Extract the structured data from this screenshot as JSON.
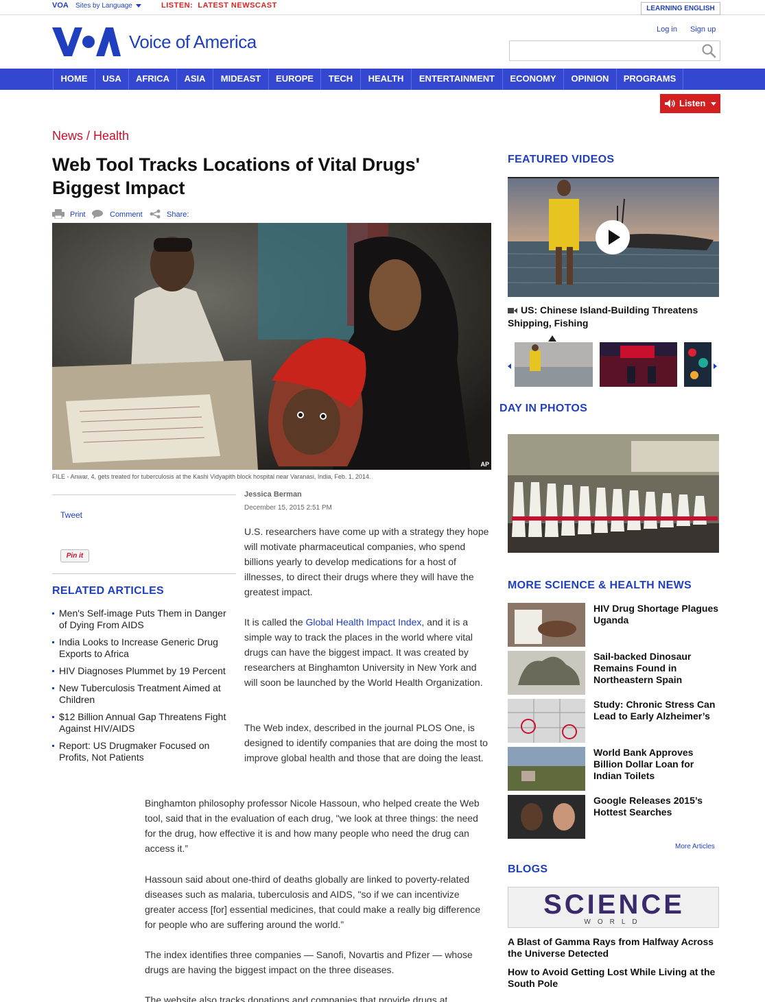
{
  "topbar": {
    "brand": "VOA",
    "sites_by_language": "Sites by Language",
    "listen_label": "LISTEN:",
    "latest_newscast": "LATEST NEWSCAST",
    "learning_english": "LEARNING ENGLISH"
  },
  "header": {
    "logo_text": "Voice of America",
    "login": "Log in",
    "signup": "Sign up",
    "search_placeholder": ""
  },
  "nav": {
    "items": [
      "HOME",
      "USA",
      "AFRICA",
      "ASIA",
      "MIDEAST",
      "EUROPE",
      "TECH",
      "HEALTH",
      "ENTERTAINMENT",
      "ECONOMY",
      "OPINION",
      "PROGRAMS"
    ]
  },
  "listen_button": "Listen",
  "article": {
    "breadcrumb": "News / Health",
    "headline": "Web Tool Tracks Locations of Vital Drugs' Biggest Impact",
    "actions": {
      "print": "Print",
      "comment": "Comment",
      "share": "Share:"
    },
    "photo_credit": "AP",
    "caption": "FILE - Anwar, 4, gets treated for tuberculosis at the Kashi Vidyapith block hospital near Varanasi, India, Feb. 1, 2014.",
    "author": "Jessica Berman",
    "date": "December 15, 2015 2:51 PM",
    "social": {
      "tweet": "Tweet",
      "pinit": "Pin it"
    },
    "paragraphs": {
      "p1": "U.S. researchers have come up with a strategy they hope will motivate pharmaceutical companies, who spend billions yearly to develop medications for a host of illnesses, to direct their drugs where they will have the greatest impact.",
      "p2_pre": "It is called the ",
      "p2_link": "Global Health Impact Index",
      "p2_post": ", and it is a simple way to track the places in the world where vital drugs can have the biggest impact. It was created by researchers at Binghamton University in New York and will soon be launched by the World Health Organization.",
      "p3": "The Web index, described in the journal PLOS One, is designed to identify companies that are doing the most to improve global health and those that are doing the least.",
      "p4": "Binghamton philosophy professor Nicole Hassoun, who helped create the Web tool, said that in the evaluation of each drug, \"we look at three things: the need for the drug, how effective it is and how many people who need the drug can access it.”",
      "p5": "Hassoun said about one-third of deaths globally are linked to poverty-related diseases such as malaria, tuberculosis and AIDS, \"so if we can incentivize greater access [for] essential medicines, that could make a really big difference for people who are suffering around the world.”",
      "p6": "The index identifies three companies — Sanofi, Novartis and Pfizer — whose drugs are having the biggest impact on the three diseases.",
      "p7": "The website also tracks donations and companies that provide drugs at"
    }
  },
  "related": {
    "title": "RELATED ARTICLES",
    "items": [
      "Men's Self-image Puts Them in Danger of Dying From AIDS",
      "India Looks to Increase Generic Drug Exports to Africa",
      "HIV Diagnoses Plummet by 19 Percent",
      "New Tuberculosis Treatment Aimed at Children",
      "$12 Billion Annual Gap Threatens Fight Against HIV/AIDS",
      "Report: US Drugmaker Focused on Profits, Not Patients"
    ]
  },
  "sidebar": {
    "featured_videos": {
      "title": "FEATURED VIDEOS",
      "video_title": "US: Chinese Island-Building Threatens Shipping, Fishing"
    },
    "day_in_photos": {
      "title": "DAY IN PHOTOS"
    },
    "more_news": {
      "title": "MORE SCIENCE & HEALTH NEWS",
      "items": [
        "HIV Drug Shortage Plagues Uganda",
        "Sail-backed Dinosaur Remains Found in Northeastern Spain",
        "Study: Chronic Stress Can Lead to Early Alzheimer’s",
        "World Bank Approves Billion Dollar Loan for Indian Toilets",
        "Google Releases 2015’s Hottest Searches"
      ],
      "more_link": "More Articles"
    },
    "blogs": {
      "title": "BLOGS",
      "banner_text": "SCIENCE",
      "banner_sub": "WORLD",
      "items": [
        "A Blast of Gamma Rays from Halfway Across the Universe Detected",
        "How to Avoid Getting Lost While Living at the South Pole"
      ]
    }
  },
  "colors": {
    "brand_blue": "#3347d1",
    "link_blue": "#1f3fbf",
    "accent_red": "#c8102e"
  }
}
